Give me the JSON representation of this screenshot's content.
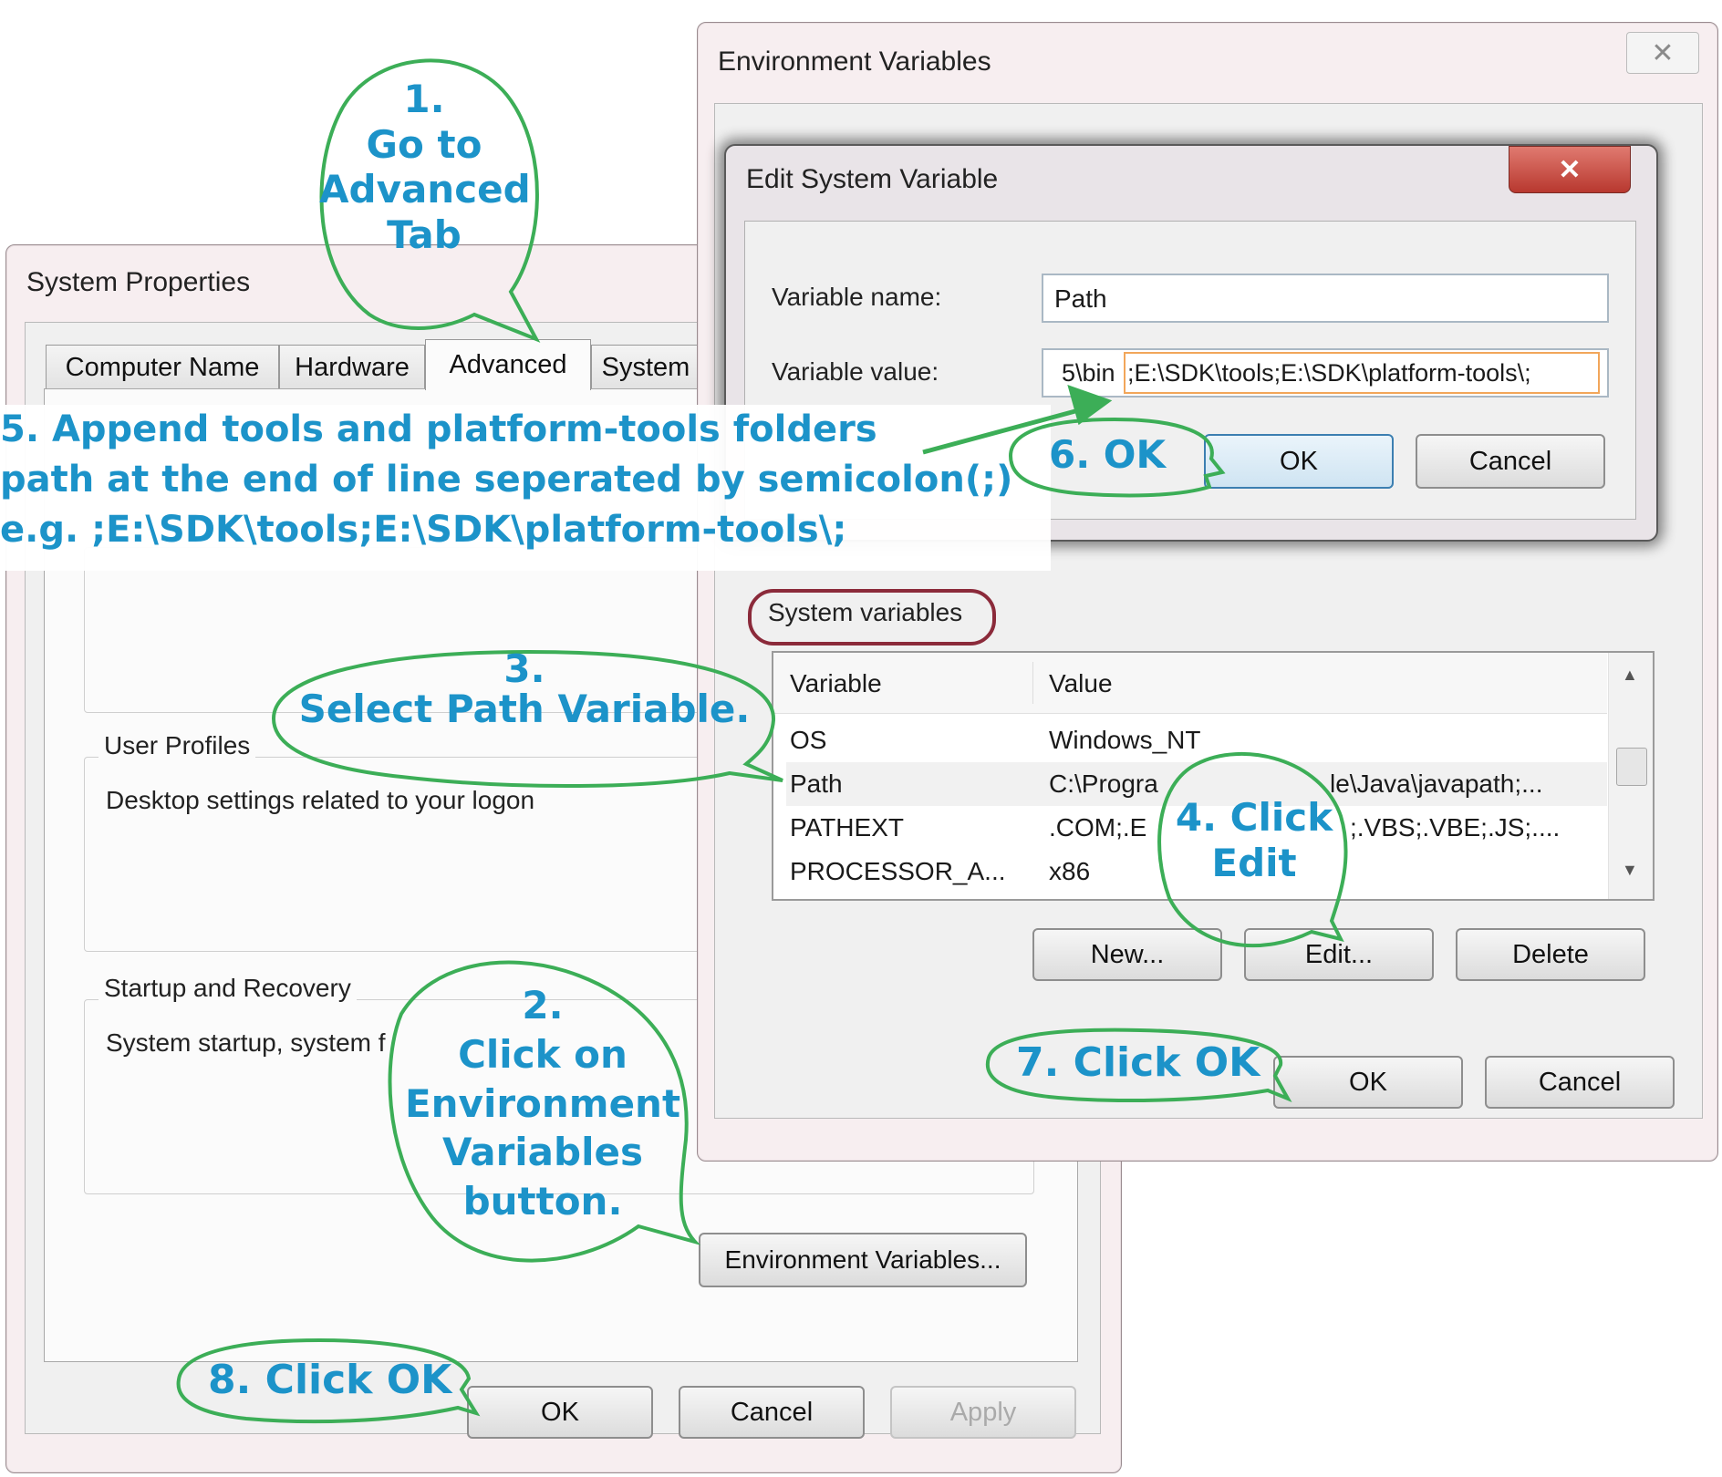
{
  "system_properties": {
    "title": "System Properties",
    "tabs": [
      {
        "label": "Computer Name"
      },
      {
        "label": "Hardware"
      },
      {
        "label": "Advanced"
      },
      {
        "label": "System"
      }
    ],
    "user_profiles": {
      "title": "User Profiles",
      "description": "Desktop settings related to your logon"
    },
    "startup_recovery": {
      "title": "Startup and Recovery",
      "description": "System startup, system f"
    },
    "env_vars_button": "Environment Variables...",
    "ok_button": "OK",
    "cancel_button": "Cancel",
    "apply_button": "Apply"
  },
  "environment_variables": {
    "title": "Environment Variables",
    "system_variables_label": "System variables",
    "columns": [
      "Variable",
      "Value"
    ],
    "rows": [
      {
        "variable": "OS",
        "value": "Windows_NT"
      },
      {
        "variable": "Path",
        "value": "C:\\Progra",
        "value_tail": "le\\Java\\javapath;..."
      },
      {
        "variable": "PATHEXT",
        "value": ".COM;.E",
        "value_tail": ";.VBS;.VBE;.JS;...."
      },
      {
        "variable": "PROCESSOR_A...",
        "value": "x86"
      }
    ],
    "new_button": "New...",
    "edit_button": "Edit...",
    "delete_button": "Delete",
    "ok_button": "OK",
    "cancel_button": "Cancel"
  },
  "edit_system_variable": {
    "title": "Edit System Variable",
    "name_label": "Variable name:",
    "value_label": "Variable value:",
    "name_value": "Path",
    "value_prefix": "5\\bin",
    "value_appended": ";E:\\SDK\\tools;E:\\SDK\\platform-tools\\;",
    "ok_button": "OK",
    "cancel_button": "Cancel"
  },
  "annotations": {
    "step1": [
      "1.",
      "Go to",
      "Advanced",
      "Tab"
    ],
    "step2": [
      "2.",
      "Click on",
      "Environment",
      "Variables",
      "button."
    ],
    "step3": [
      "3.",
      "Select Path Variable."
    ],
    "step4": [
      "4. Click",
      "Edit"
    ],
    "step5": [
      "5. Append tools and platform-tools folders",
      "path at the end of line seperated by semicolon(;)",
      "e.g. ;E:\\SDK\\tools;E:\\SDK\\platform-tools\\;"
    ],
    "step6": "6. OK",
    "step7": "7. Click OK",
    "step8": "8. Click OK"
  },
  "colors": {
    "callout_text": "#1c93c9",
    "callout_border": "#3cae57",
    "highlight_box": "#8b2a3a",
    "close_button": "#c8443c",
    "appended_box": "#f2a65a"
  }
}
